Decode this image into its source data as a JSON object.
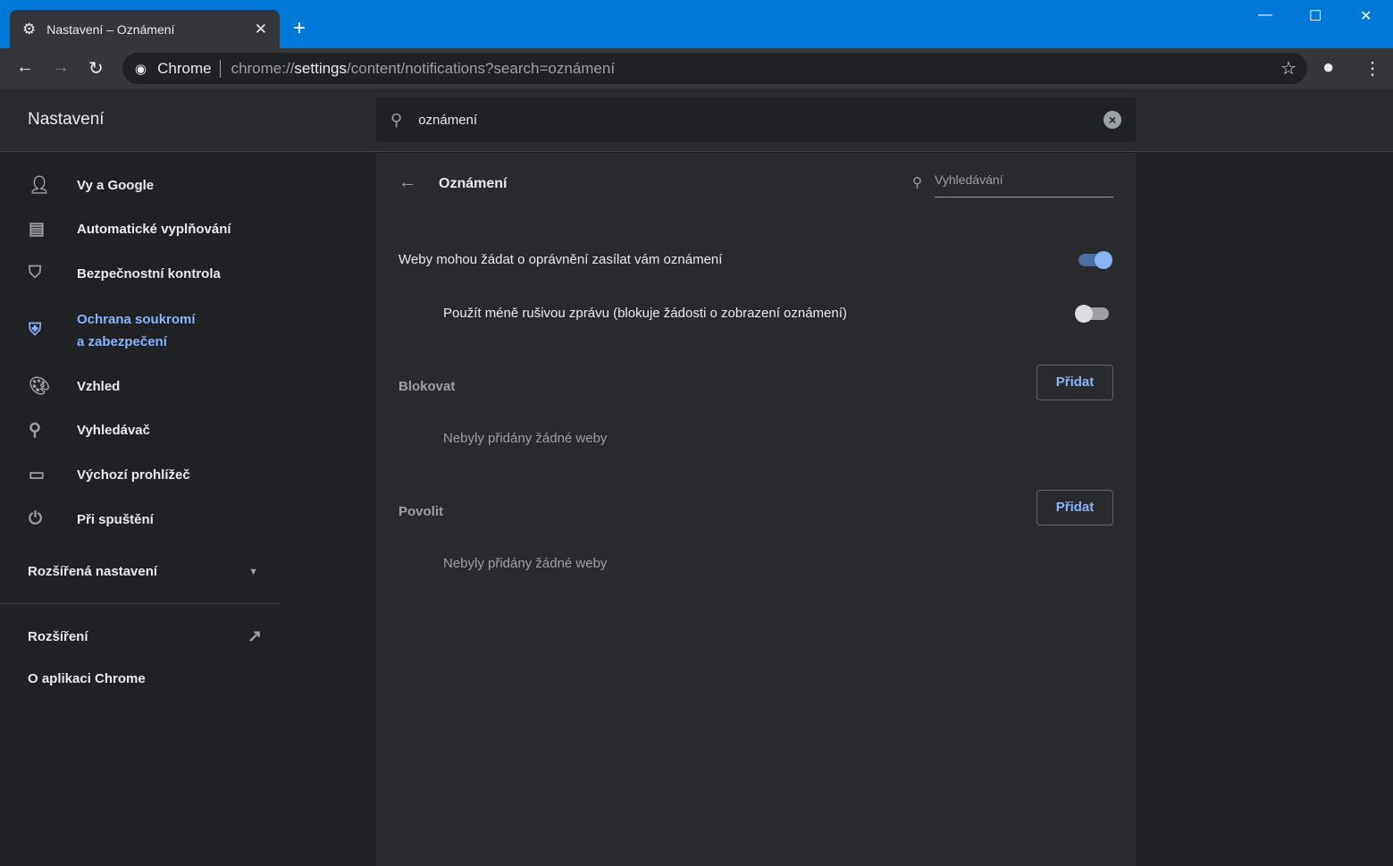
{
  "browser": {
    "tab_title": "Nastavení – Oznámení",
    "omnibox_chip": "Chrome",
    "url_scheme": "chrome://",
    "url_host": "settings",
    "url_path": "/content/notifications?search=oznámení"
  },
  "header": {
    "title": "Nastavení",
    "search_value": "oznámení"
  },
  "sidebar": {
    "items": [
      {
        "label": "Vy a Google",
        "icon": "person-icon"
      },
      {
        "label": "Automatické vyplňování",
        "icon": "clipboard-icon"
      },
      {
        "label": "Bezpečnostní kontrola",
        "icon": "shield-check-icon"
      },
      {
        "label": "Ochrana soukromí",
        "label2": "a zabezpečení",
        "icon": "shield-icon"
      },
      {
        "label": "Vzhled",
        "icon": "palette-icon"
      },
      {
        "label": "Vyhledávač",
        "icon": "search-icon"
      },
      {
        "label": "Výchozí prohlížeč",
        "icon": "browser-icon"
      },
      {
        "label": "Při spuštění",
        "icon": "power-icon"
      }
    ],
    "advanced": "Rozšířená nastavení",
    "extensions": "Rozšíření",
    "about": "O aplikaci Chrome"
  },
  "main": {
    "title": "Oznámení",
    "search_placeholder": "Vyhledávání",
    "ask_label": "Weby mohou žádat o oprávnění zasílat vám oznámení",
    "ask_enabled": true,
    "quiet_label": "Použít méně rušivou zprávu (blokuje žádosti o zobrazení oznámení)",
    "quiet_enabled": false,
    "block_title": "Blokovat",
    "block_add": "Přidat",
    "block_empty": "Nebyly přidány žádné weby",
    "allow_title": "Povolit",
    "allow_add": "Přidat",
    "allow_empty": "Nebyly přidány žádné weby"
  },
  "colors": {
    "accent": "#8ab4f8",
    "titlebar": "#0078d7"
  }
}
